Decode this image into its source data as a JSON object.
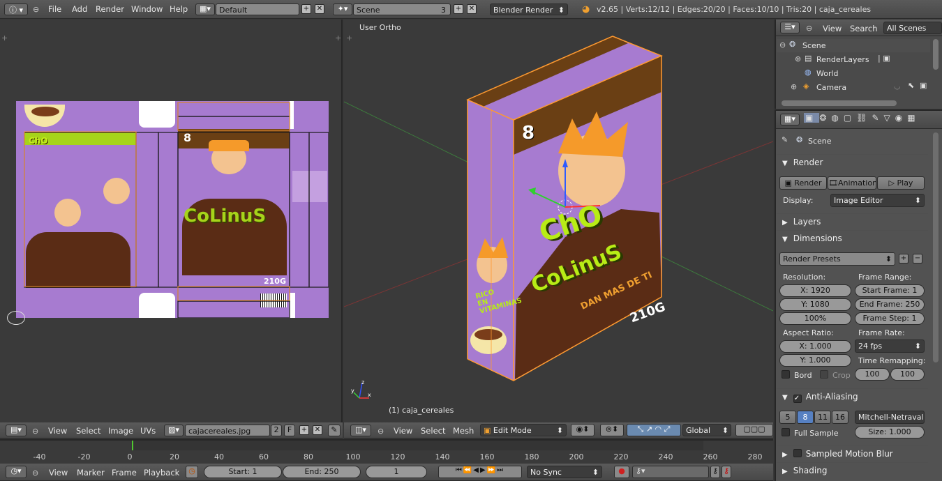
{
  "app": {
    "version_info": "v2.65 | Verts:12/12 | Edges:20/20 | Faces:10/10 | Tris:20 | caja_cereales"
  },
  "top_menu": [
    "File",
    "Add",
    "Render",
    "Window",
    "Help"
  ],
  "screen_layout": "Default",
  "scene_name": "Scene",
  "scene_users": "3",
  "render_engine": "Blender Render",
  "uv_editor": {
    "menus": [
      "View",
      "Select",
      "Image",
      "UVs"
    ],
    "image_name": "cajacereales.jpg",
    "users": "2",
    "fake_user": "F"
  },
  "viewport": {
    "label": "User Ortho",
    "object_label": "(1) caja_cereales",
    "menus": [
      "View",
      "Select",
      "Mesh"
    ],
    "mode": "Edit Mode",
    "orientation": "Global"
  },
  "outliner": {
    "menus": [
      "View",
      "Search"
    ],
    "filter": "All Scenes",
    "items": [
      "Scene",
      "RenderLayers",
      "World",
      "Camera"
    ]
  },
  "properties": {
    "context": "Scene",
    "render_panel": "Render",
    "render_buttons": [
      "Render",
      "Animation",
      "Play"
    ],
    "display_label": "Display:",
    "display_value": "Image Editor",
    "layers_panel": "Layers",
    "dimensions_panel": "Dimensions",
    "render_presets": "Render Presets",
    "resolution_label": "Resolution:",
    "res_x": "X: 1920",
    "res_y": "Y: 1080",
    "res_pct": "100%",
    "frame_range_label": "Frame Range:",
    "start_frame": "Start Frame: 1",
    "end_frame": "End Frame: 250",
    "frame_step": "Frame Step: 1",
    "aspect_label": "Aspect Ratio:",
    "aspect_x": "X: 1.000",
    "aspect_y": "Y: 1.000",
    "frame_rate_label": "Frame Rate:",
    "frame_rate": "24 fps",
    "time_remap_label": "Time Remapping:",
    "remap_old": "100",
    "remap_new": "100",
    "bord": "Bord",
    "crop": "Crop",
    "aa_panel": "Anti-Aliasing",
    "aa_samples": [
      "5",
      "8",
      "11",
      "16"
    ],
    "aa_filter": "Mitchell-Netravali",
    "full_sample": "Full Sample",
    "size": "Size: 1.000",
    "motion_blur": "Sampled Motion Blur",
    "shading": "Shading"
  },
  "timeline": {
    "ticks": [
      "-40",
      "-20",
      "0",
      "20",
      "40",
      "60",
      "80",
      "100",
      "120",
      "140",
      "160",
      "180",
      "200",
      "220",
      "240",
      "260",
      "280"
    ],
    "menus": [
      "View",
      "Marker",
      "Frame",
      "Playback"
    ],
    "start": "Start: 1",
    "end": "End: 250",
    "current": "1",
    "sync": "No Sync"
  },
  "box_art": {
    "brand_a": "ChO",
    "brand_b": "CoLinuS",
    "slogan": "DAN MAS DE TI",
    "weight": "210G",
    "number": "8",
    "vitamins": "RICO EN VITAMINAS"
  },
  "colors": {
    "purple": "#a77bd0",
    "brown": "#6a3f14",
    "green": "#a6d41a",
    "orange": "#f59a2a",
    "selection": "#ff9a30"
  }
}
